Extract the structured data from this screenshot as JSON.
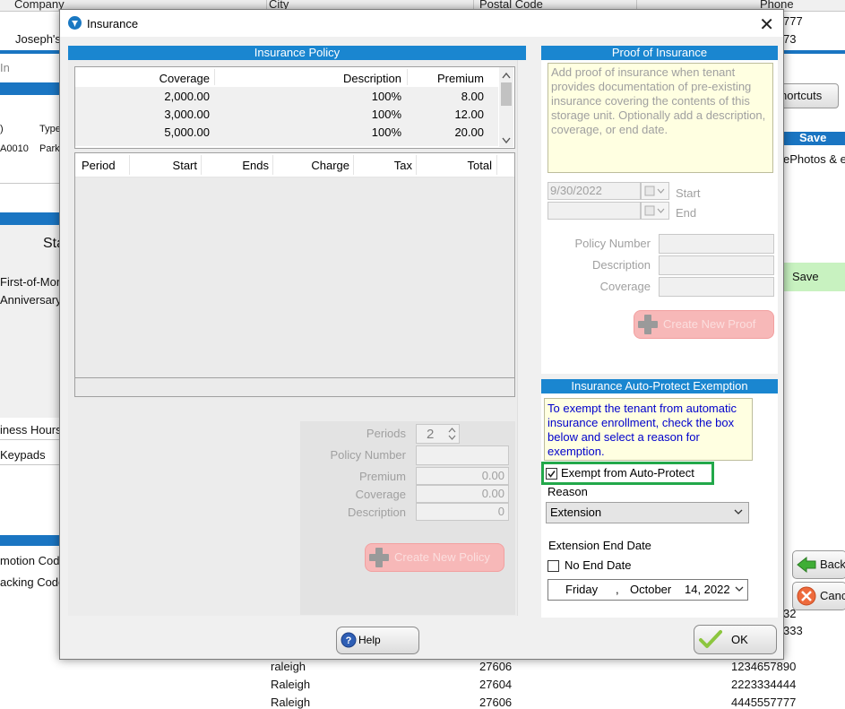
{
  "background": {
    "columns": [
      "Company",
      "City",
      "Postal Code",
      "Phone"
    ],
    "left_texts": [
      "Joseph's",
      "In",
      ")",
      "Type",
      "A0010",
      "Park",
      "Sta",
      "First-of-Mont",
      "Anniversary",
      "iness Hours",
      "Keypads",
      "motion Code",
      "acking Code"
    ],
    "right_texts": {
      "phone_top_1": "777",
      "phone_top_2": "73",
      "shortcuts": "hortcuts",
      "save_header": "Save",
      "photos": "ePhotos & eF",
      "save_button": "Save",
      "back_button": "Back",
      "cancel_button": "Canc",
      "row_a": "32",
      "row_b": "333"
    },
    "rows": [
      {
        "city": "raleigh",
        "postal": "27606",
        "phone": "1234657890"
      },
      {
        "city": "Raleigh",
        "postal": "27604",
        "phone": "2223334444"
      },
      {
        "city": "Raleigh",
        "postal": "27606",
        "phone": "4445557777"
      }
    ]
  },
  "dialog": {
    "title": "Insurance",
    "close_glyph": "✕",
    "policy": {
      "header": "Insurance Policy",
      "coverage_columns": [
        "Coverage",
        "Description",
        "Premium"
      ],
      "coverage_rows": [
        {
          "coverage": "2,000.00",
          "description": "100%",
          "premium": "8.00"
        },
        {
          "coverage": "3,000.00",
          "description": "100%",
          "premium": "12.00"
        },
        {
          "coverage": "5,000.00",
          "description": "100%",
          "premium": "20.00"
        }
      ],
      "period_columns": [
        "Period",
        "Start",
        "Ends",
        "Charge",
        "Tax",
        "Total"
      ],
      "periods_label": "Periods",
      "periods_value": "2",
      "policy_number_label": "Policy Number",
      "premium_label": "Premium",
      "premium_value": "0.00",
      "coverage_label": "Coverage",
      "coverage_value": "0.00",
      "description_label": "Description",
      "description_value": "0",
      "create_button": "Create New Policy"
    },
    "proof": {
      "header": "Proof of Insurance",
      "note": "Add proof of insurance when tenant provides documentation of pre-existing insurance covering the contents of this storage unit.  Optionally add a description, coverage, or end date.",
      "start_date": "9/30/2022",
      "start_label": "Start",
      "end_label": "End",
      "policy_number_label": "Policy Number",
      "description_label": "Description",
      "coverage_label": "Coverage",
      "create_button": "Create New Proof"
    },
    "exemption": {
      "header": "Insurance Auto-Protect Exemption",
      "note": "To exempt the tenant from automatic insurance enrollment, check the box below and select a reason for exemption.",
      "checkbox_label": "Exempt from Auto-Protect",
      "checkbox_checked": true,
      "reason_label": "Reason",
      "reason_value": "Extension",
      "end_date_label": "Extension End Date",
      "no_end_date_label": "No End Date",
      "date_day": "Friday",
      "date_sep": ",",
      "date_month": "October",
      "date_rest": "14, 2022"
    },
    "help_button": "Help",
    "ok_button": "OK"
  },
  "colors": {
    "header_blue": "#1a86d0",
    "highlight_green": "#22a84a",
    "note_blue_text": "#0000cc",
    "disabled_pink": "#f7b8b8"
  }
}
